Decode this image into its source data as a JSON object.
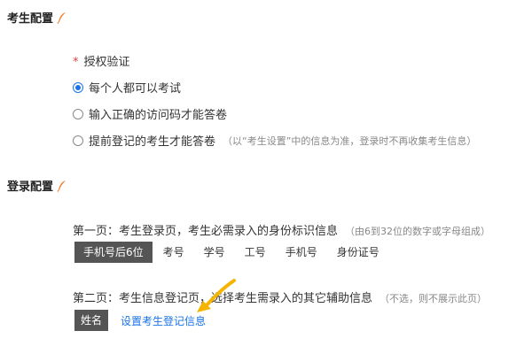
{
  "exam_config": {
    "title": "考生配置",
    "required_mark": "*",
    "auth_label": "授权验证",
    "options": [
      {
        "label": "每个人都可以考试",
        "selected": true
      },
      {
        "label": "输入正确的访问码才能答卷",
        "selected": false
      },
      {
        "label": "提前登记的考生才能答卷",
        "selected": false,
        "note": "（以“考生设置”中的信息为准，登录时不再收集考生信息）"
      }
    ]
  },
  "login_config": {
    "title": "登录配置",
    "page1": {
      "text": "第一页：考生登录页，考生必需录入的身份标识信息",
      "note": "（由6到32位的数字或字母组成）",
      "options": [
        "手机号后6位",
        "考号",
        "学号",
        "工号",
        "手机号",
        "身份证号"
      ],
      "active": 0
    },
    "page2": {
      "text": "第二页：考生信息登记页，选择考生需录入的其它辅助信息",
      "note": "（不选，则不展示此页）",
      "chip": "姓名",
      "link": "设置考生登记信息"
    }
  },
  "colors": {
    "accent": "#1a73e8",
    "feather": "#f07a28",
    "arrow": "#f5b400",
    "active_bg": "#555555"
  }
}
